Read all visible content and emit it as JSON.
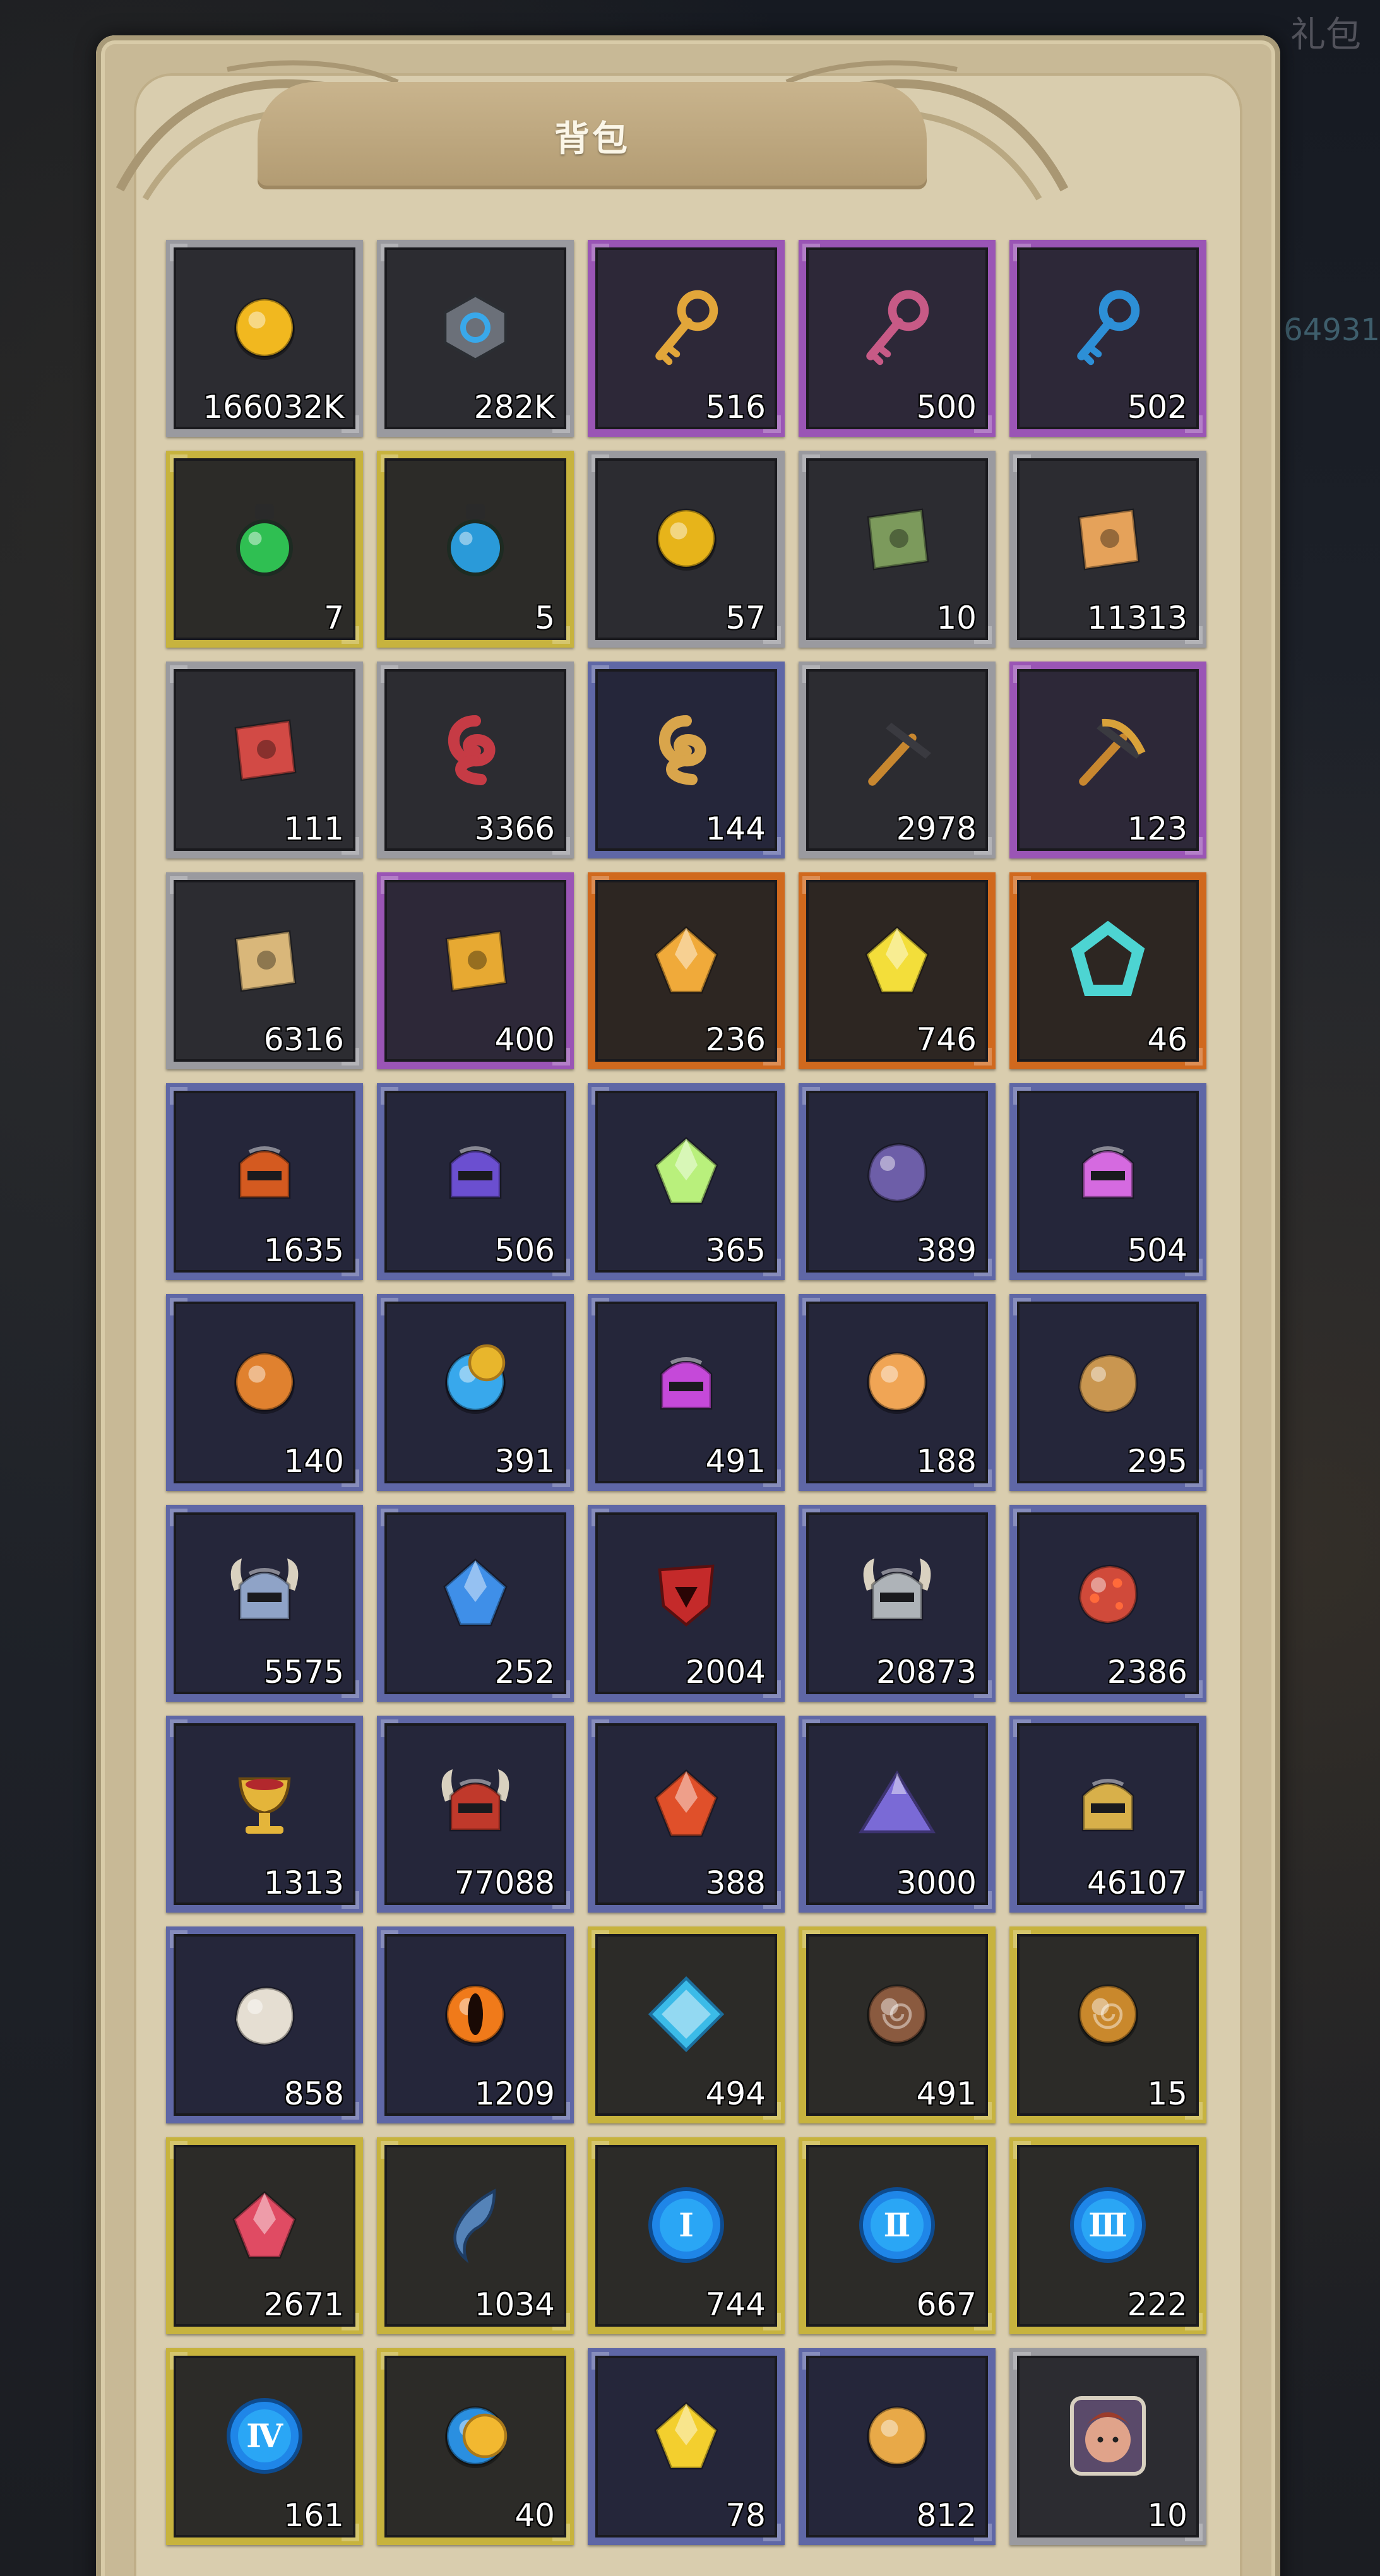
{
  "screen": {
    "title": "背包",
    "ghost_label": "礼包",
    "ghost_number": "64931"
  },
  "items": [
    {
      "count": "166032K",
      "rarity": "gray",
      "icon": "gold-coin-icon",
      "color": "#f1b81f"
    },
    {
      "count": "282K",
      "rarity": "gray",
      "icon": "hex-nut-icon",
      "color": "#6b7079"
    },
    {
      "count": "516",
      "rarity": "purple",
      "icon": "gold-key-icon",
      "color": "#e2a63a"
    },
    {
      "count": "500",
      "rarity": "purple",
      "icon": "pink-key-icon",
      "color": "#c75a86"
    },
    {
      "count": "502",
      "rarity": "purple",
      "icon": "blue-key-icon",
      "color": "#2d8fd6"
    },
    {
      "count": "7",
      "rarity": "gold",
      "icon": "green-potion-icon",
      "color": "#2fbf52"
    },
    {
      "count": "5",
      "rarity": "gold",
      "icon": "blue-potion-icon",
      "color": "#2a9ad9"
    },
    {
      "count": "57",
      "rarity": "gray",
      "icon": "gold-medal-icon",
      "color": "#e7b41a"
    },
    {
      "count": "10",
      "rarity": "gray",
      "icon": "green-map-icon",
      "color": "#7c9a5c"
    },
    {
      "count": "11313",
      "rarity": "gray",
      "icon": "orange-scroll-icon",
      "color": "#e5a25a"
    },
    {
      "count": "111",
      "rarity": "gray",
      "icon": "red-scroll-icon",
      "color": "#d24a45"
    },
    {
      "count": "3366",
      "rarity": "gray",
      "icon": "red-coil-icon",
      "color": "#c63b45"
    },
    {
      "count": "144",
      "rarity": "blue",
      "icon": "gold-coil-icon",
      "color": "#d9a54b"
    },
    {
      "count": "2978",
      "rarity": "gray",
      "icon": "hammer-icon",
      "color": "#c8872f"
    },
    {
      "count": "123",
      "rarity": "purple",
      "icon": "pickaxe-icon",
      "color": "#d9a23a"
    },
    {
      "count": "6316",
      "rarity": "gray",
      "icon": "beige-tablet-icon",
      "color": "#d9b77a"
    },
    {
      "count": "400",
      "rarity": "purple",
      "icon": "gold-tablet-icon",
      "color": "#e7a932"
    },
    {
      "count": "236",
      "rarity": "orange",
      "icon": "orange-ore-icon",
      "color": "#f0aa3a"
    },
    {
      "count": "746",
      "rarity": "orange",
      "icon": "yellow-ore-icon",
      "color": "#f3de3a"
    },
    {
      "count": "46",
      "rarity": "orange",
      "icon": "cyan-ring-icon",
      "color": "#4dd4d2"
    },
    {
      "count": "1635",
      "rarity": "blue",
      "icon": "orange-helmet-icon",
      "color": "#d45a20"
    },
    {
      "count": "506",
      "rarity": "blue",
      "icon": "purple-helmet-icon",
      "color": "#6b4fd0"
    },
    {
      "count": "365",
      "rarity": "blue",
      "icon": "green-gem-icon",
      "color": "#b9f07c"
    },
    {
      "count": "389",
      "rarity": "blue",
      "icon": "purple-heart-icon",
      "color": "#6d5ea8"
    },
    {
      "count": "504",
      "rarity": "blue",
      "icon": "pink-helmet-icon",
      "color": "#d56ae0"
    },
    {
      "count": "140",
      "rarity": "blue",
      "icon": "flame-orb-icon",
      "color": "#e0812f"
    },
    {
      "count": "391",
      "rarity": "blue",
      "icon": "ice-coin-icon",
      "color": "#38a8ec"
    },
    {
      "count": "491",
      "rarity": "blue",
      "icon": "magenta-crown-icon",
      "color": "#c549d9"
    },
    {
      "count": "188",
      "rarity": "blue",
      "icon": "fire-orb-icon",
      "color": "#f0a555"
    },
    {
      "count": "295",
      "rarity": "blue",
      "icon": "bronze-rock-icon",
      "color": "#c99650"
    },
    {
      "count": "5575",
      "rarity": "blue",
      "icon": "horned-helmet-icon",
      "color": "#8fa3c7"
    },
    {
      "count": "252",
      "rarity": "blue",
      "icon": "blue-crystal-icon",
      "color": "#3f8fe8"
    },
    {
      "count": "2004",
      "rarity": "blue",
      "icon": "red-shield-icon",
      "color": "#c42a2a"
    },
    {
      "count": "20873",
      "rarity": "blue",
      "icon": "viking-helmet-icon",
      "color": "#aeb3b8"
    },
    {
      "count": "2386",
      "rarity": "blue",
      "icon": "lava-rock-icon",
      "color": "#d04a3a"
    },
    {
      "count": "1313",
      "rarity": "blue",
      "icon": "gold-chalice-icon",
      "color": "#e4b53a"
    },
    {
      "count": "77088",
      "rarity": "blue",
      "icon": "demon-helmet-icon",
      "color": "#c0392b"
    },
    {
      "count": "388",
      "rarity": "blue",
      "icon": "volcanic-ore-icon",
      "color": "#e0502a"
    },
    {
      "count": "3000",
      "rarity": "blue",
      "icon": "purple-mountain-icon",
      "color": "#7a6ad6"
    },
    {
      "count": "46107",
      "rarity": "blue",
      "icon": "gold-helmet-icon",
      "color": "#d8b04a"
    },
    {
      "count": "858",
      "rarity": "blue",
      "icon": "white-shell-icon",
      "color": "#e5ded2"
    },
    {
      "count": "1209",
      "rarity": "blue",
      "icon": "fire-eye-icon",
      "color": "#f07a1a"
    },
    {
      "count": "494",
      "rarity": "gold",
      "icon": "blue-diamond-icon",
      "color": "#3bbbe8"
    },
    {
      "count": "491",
      "rarity": "gold",
      "icon": "brown-disc-icon",
      "color": "#8a5a3f"
    },
    {
      "count": "15",
      "rarity": "gold",
      "icon": "spiral-disc-icon",
      "color": "#c9882c"
    },
    {
      "count": "2671",
      "rarity": "gold",
      "icon": "red-crystal-cluster-icon",
      "color": "#e04b63"
    },
    {
      "count": "1034",
      "rarity": "gold",
      "icon": "blue-blade-icon",
      "color": "#5583b8"
    },
    {
      "count": "744",
      "rarity": "gold",
      "icon": "rune-one-icon",
      "color": "#1f86e8",
      "glyph": "Ⅰ"
    },
    {
      "count": "667",
      "rarity": "gold",
      "icon": "rune-two-icon",
      "color": "#1f86e8",
      "glyph": "Ⅱ"
    },
    {
      "count": "222",
      "rarity": "gold",
      "icon": "rune-three-icon",
      "color": "#1f86e8",
      "glyph": "Ⅲ"
    },
    {
      "count": "161",
      "rarity": "gold",
      "icon": "rune-four-icon",
      "color": "#1f86e8",
      "glyph": "Ⅳ"
    },
    {
      "count": "40",
      "rarity": "gold",
      "icon": "blue-gold-coin-icon",
      "color": "#2a8fe0"
    },
    {
      "count": "78",
      "rarity": "blue",
      "icon": "yellow-gem-icon",
      "color": "#f3cf2e"
    },
    {
      "count": "812",
      "rarity": "blue",
      "icon": "gold-seal-icon",
      "color": "#e8a948"
    },
    {
      "count": "10",
      "rarity": "gray",
      "icon": "hero-portrait-icon",
      "color": "#e0a38a"
    }
  ]
}
